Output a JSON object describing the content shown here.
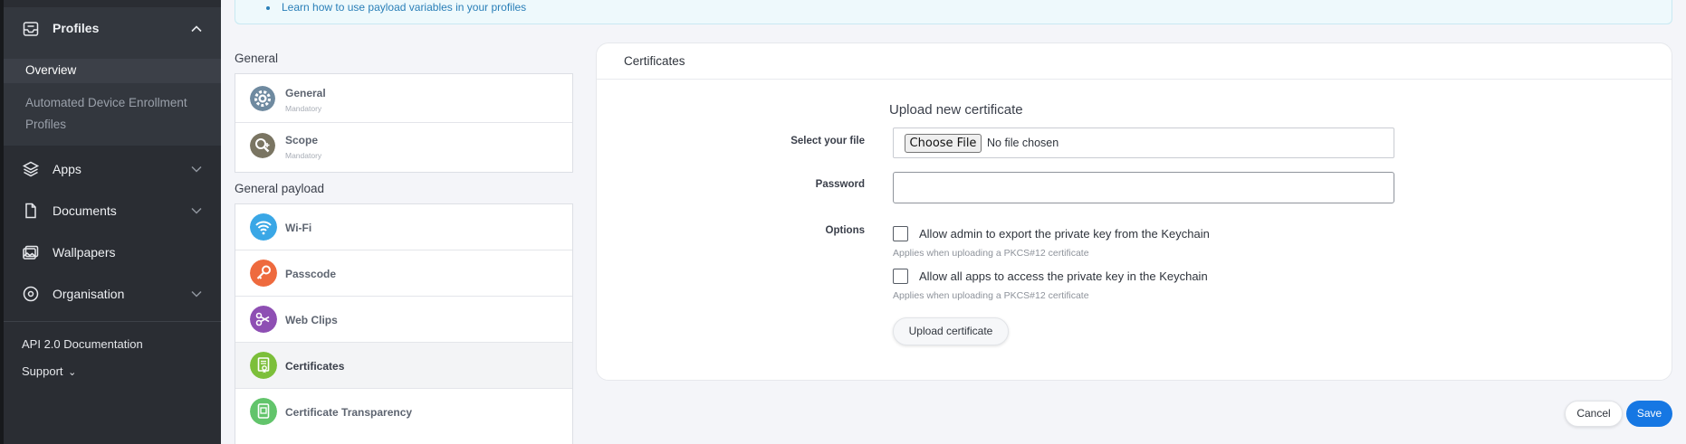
{
  "sidebar": {
    "profiles_label": "Profiles",
    "overview_label": "Overview",
    "ade_label": "Automated Device Enrollment Profiles",
    "apps_label": "Apps",
    "documents_label": "Documents",
    "wallpapers_label": "Wallpapers",
    "organisation_label": "Organisation",
    "api_docs_label": "API 2.0 Documentation",
    "support_label": "Support",
    "support_chevron": "⌄"
  },
  "banner": {
    "link_text": "Learn how to use payload variables in your profiles"
  },
  "payloads": {
    "general_section": "General",
    "general_items": [
      {
        "label": "General",
        "sub": "Mandatory",
        "icon": "gear-icon"
      },
      {
        "label": "Scope",
        "sub": "Mandatory",
        "icon": "scope-icon"
      }
    ],
    "general_payload_section": "General payload",
    "payload_items": [
      {
        "label": "Wi-Fi",
        "icon": "wifi-icon",
        "color": "#3aa7e6"
      },
      {
        "label": "Passcode",
        "icon": "key-icon",
        "color": "#ee6a3e"
      },
      {
        "label": "Web Clips",
        "icon": "scissors-icon",
        "color": "#8e4fb3"
      },
      {
        "label": "Certificates",
        "icon": "certificate-icon",
        "color": "#7cbf3a"
      },
      {
        "label": "Certificate Transparency",
        "icon": "certificate-transparency-icon",
        "color": "#62c46b"
      }
    ]
  },
  "certificates": {
    "panel_title": "Certificates",
    "upload_title": "Upload new certificate",
    "file_label": "Select your file",
    "choose_file_label": "Choose File",
    "no_file_text": "No file chosen",
    "password_label": "Password",
    "password_value": "",
    "options_label": "Options",
    "option1_label": "Allow admin to export the private key from the Keychain",
    "option1_hint": "Applies when uploading a PKCS#12 certificate",
    "option1_checked": false,
    "option2_label": "Allow all apps to access the private key in the Keychain",
    "option2_hint": "Applies when uploading a PKCS#12 certificate",
    "option2_checked": false,
    "upload_button": "Upload certificate"
  },
  "footer": {
    "cancel_label": "Cancel",
    "save_label": "Save"
  },
  "colors": {
    "sidebar_bg": "#2a2d33",
    "accent": "#1677e3",
    "link": "#2a7fb8"
  }
}
